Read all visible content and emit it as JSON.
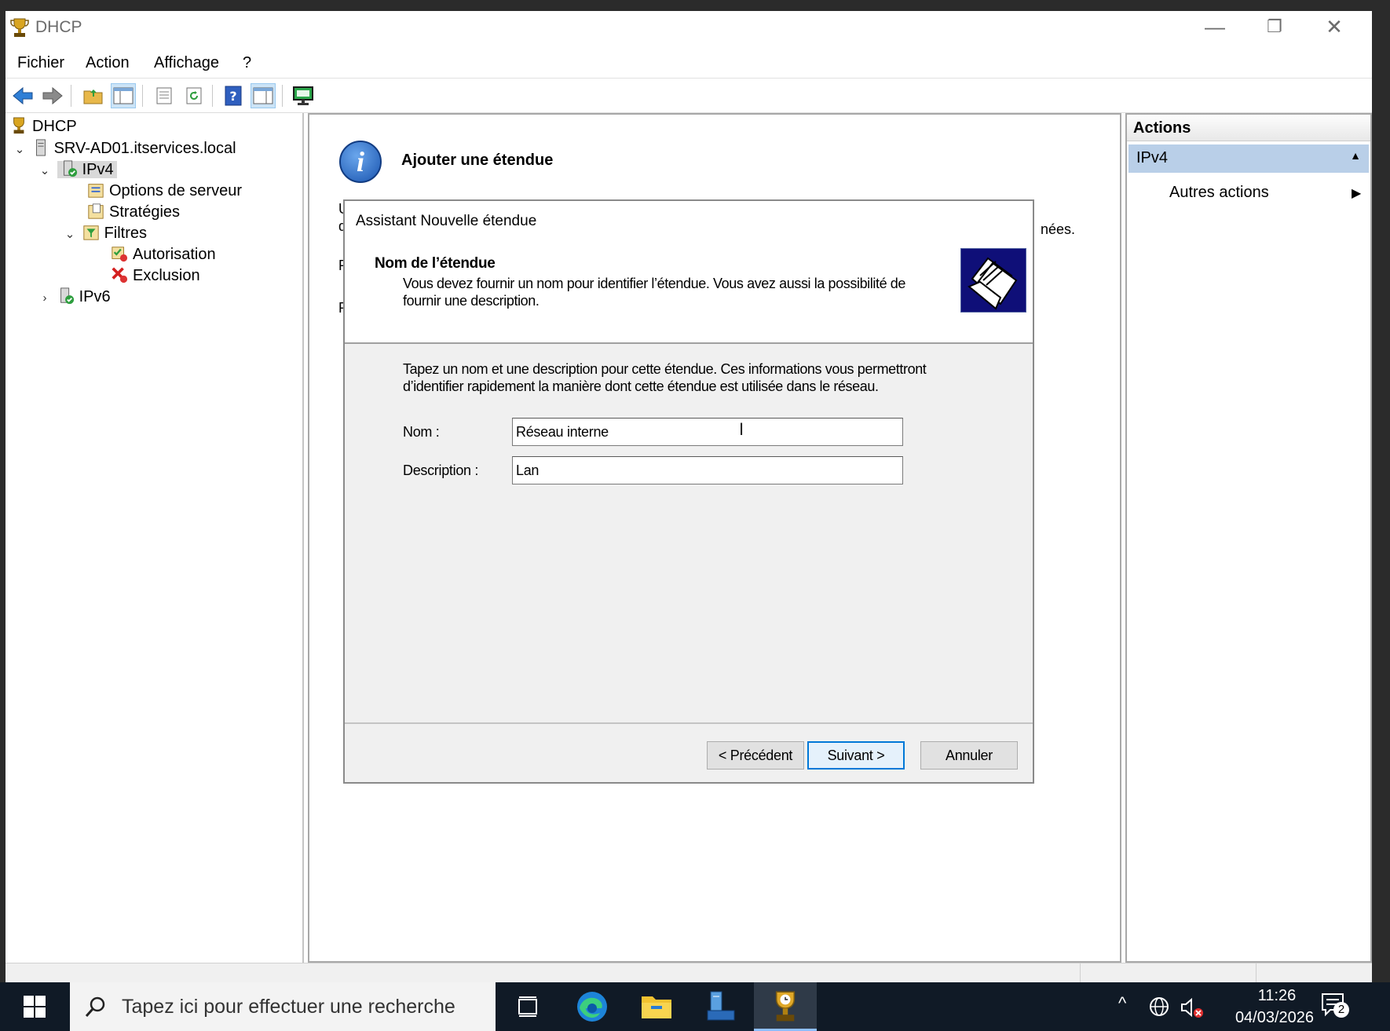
{
  "window": {
    "title": "DHCP",
    "minimize": "—",
    "restore": "❐",
    "close": "✕"
  },
  "menubar": [
    "Fichier",
    "Action",
    "Affichage",
    "?"
  ],
  "tree": {
    "root": "DHCP",
    "server": "SRV-AD01.itservices.local",
    "ipv4": "IPv4",
    "server_options": "Options de serveur",
    "policies": "Stratégies",
    "filters": "Filtres",
    "authorization": "Autorisation",
    "exclusion": "Exclusion",
    "ipv6": "IPv6"
  },
  "center": {
    "title": "Ajouter une étendue",
    "clip_u": "U",
    "clip_d": "d",
    "clip_p1": "P",
    "clip_p2": "P",
    "clip_right": "nées."
  },
  "wizard": {
    "title": "Assistant Nouvelle étendue",
    "step_title": "Nom de l’étendue",
    "step_subtitle": "Vous devez fournir un nom pour identifier l’étendue. Vous avez aussi la possibilité de fournir une description.",
    "instructions": "Tapez un nom et une description pour cette étendue. Ces informations vous permettront d’identifier rapidement la manière dont cette étendue est utilisée dans le réseau.",
    "name_label": "Nom :",
    "name_value": "Réseau interne",
    "description_label": "Description :",
    "description_value": "Lan",
    "back_button": "< Précédent",
    "next_button": "Suivant >",
    "cancel_button": "Annuler"
  },
  "actions": {
    "header": "Actions",
    "section": "IPv4",
    "more_actions": "Autres actions"
  },
  "taskbar": {
    "search_placeholder": "Tapez ici pour effectuer une recherche",
    "time": "11:26",
    "date": "04/03/2026",
    "notification_count": "2"
  }
}
